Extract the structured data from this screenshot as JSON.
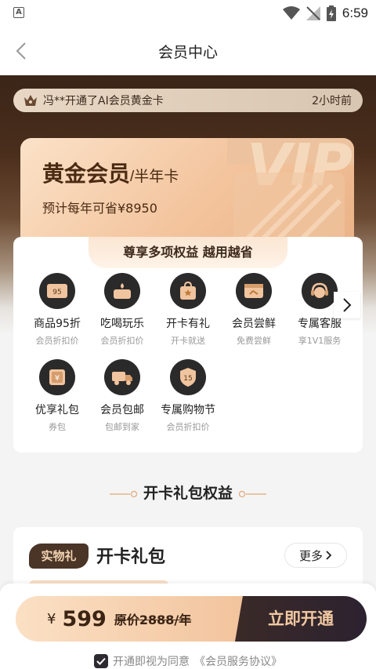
{
  "status_bar": {
    "time": "6:59",
    "app_letter": "A"
  },
  "nav": {
    "title": "会员中心"
  },
  "ticker": {
    "text": "冯**开通了AI会员黄金卡",
    "time": "2小时前"
  },
  "card": {
    "title": "黄金会员",
    "subtitle": "/半年卡",
    "saving": "预计每年可省¥8950",
    "watermark": "VIP"
  },
  "benefits": {
    "header": "尊享多项权益 越用越省",
    "items": [
      {
        "label": "商品95折",
        "desc": "会员折扣价",
        "icon": "discount-95-icon"
      },
      {
        "label": "吃喝玩乐",
        "desc": "会员折扣价",
        "icon": "food-icon"
      },
      {
        "label": "开卡有礼",
        "desc": "开卡就送",
        "icon": "gift-bag-icon"
      },
      {
        "label": "会员尝鲜",
        "desc": "免费尝鲜",
        "icon": "trial-icon"
      },
      {
        "label": "专属客服",
        "desc": "享1V1服务",
        "icon": "headset-icon"
      },
      {
        "label": "优享礼包",
        "desc": "券包",
        "icon": "coupon-icon"
      },
      {
        "label": "会员包邮",
        "desc": "包邮到家",
        "icon": "truck-icon"
      },
      {
        "label": "专属购物节",
        "desc": "会员折扣价",
        "icon": "badge-15-icon"
      }
    ]
  },
  "section": {
    "title": "开卡礼包权益"
  },
  "gift": {
    "badge": "实物礼",
    "title": "开卡礼包",
    "more": "更多"
  },
  "bottom": {
    "currency": "¥",
    "price": "599",
    "original_price": "原价2888/年",
    "pay_button": "立即开通",
    "agreement_prefix": "开通即视为同意",
    "agreement_link": "《会员服务协议》"
  },
  "colors": {
    "accent_dark": "#2c2230",
    "gold": "#f2c39c",
    "brown": "#4a2a12"
  }
}
